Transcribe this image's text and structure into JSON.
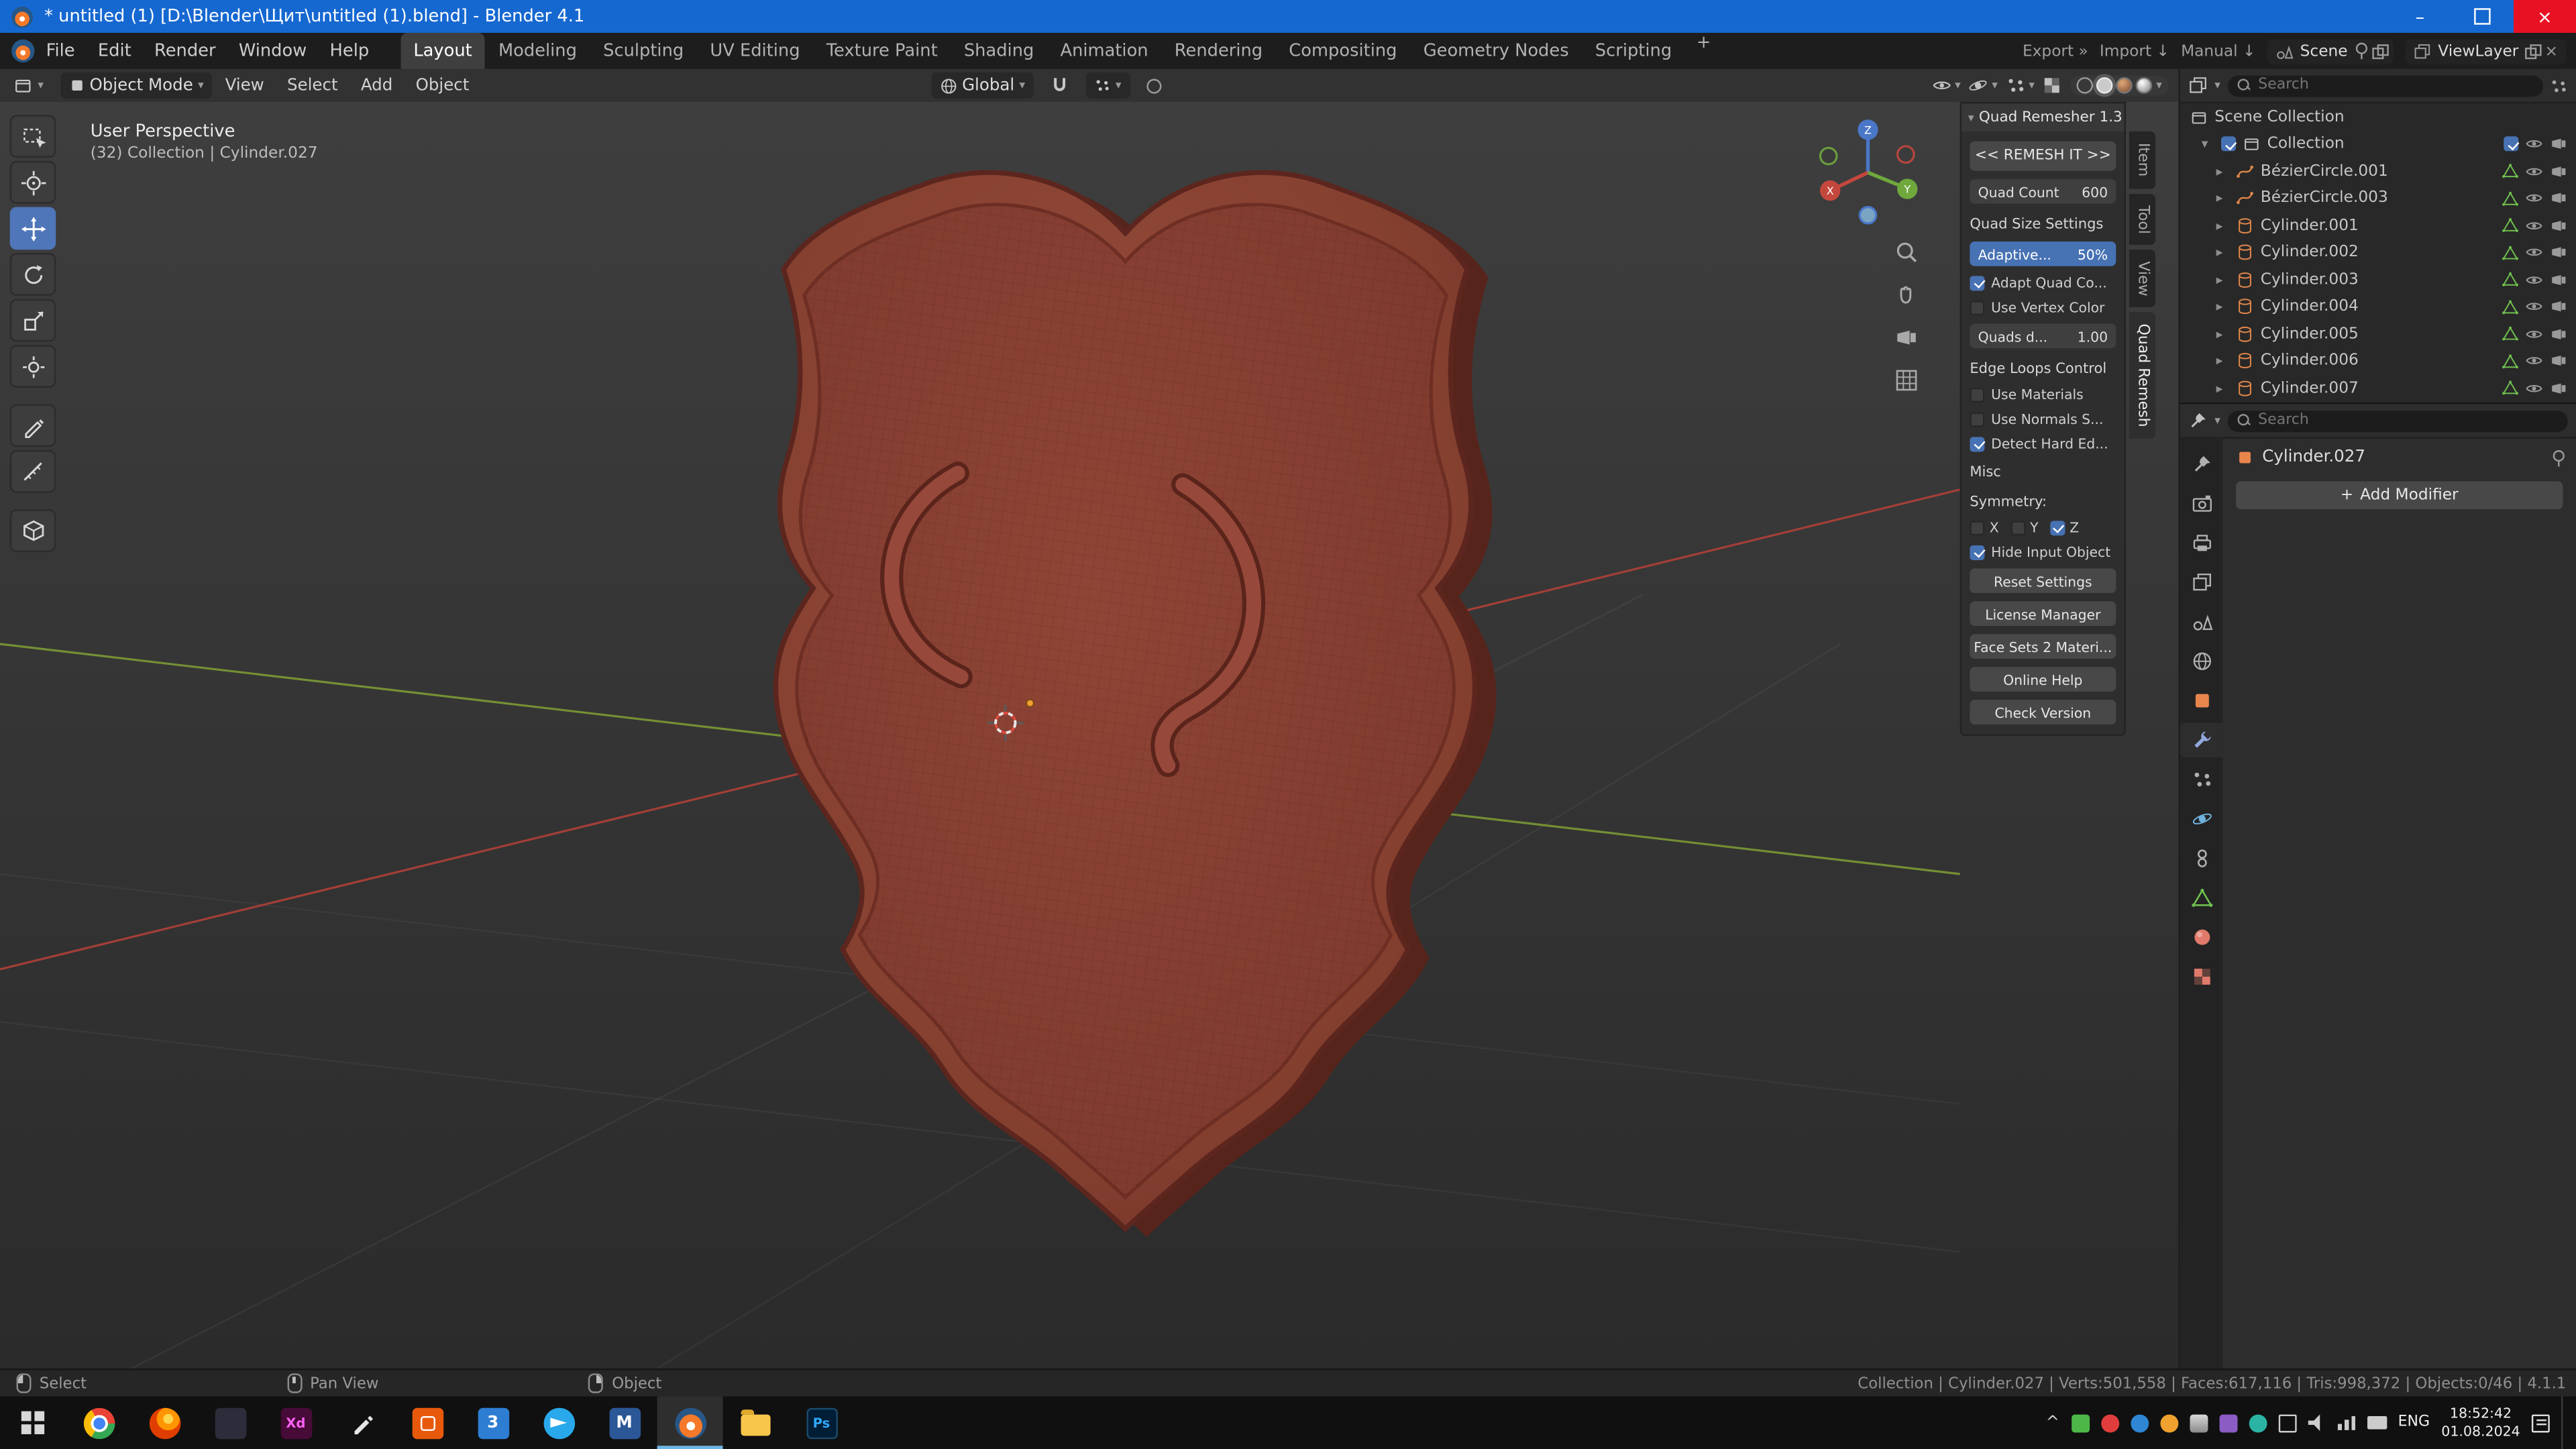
{
  "colors": {
    "titlebar_blue": "#1668d1",
    "accent_blue": "#4772b3",
    "blender_orange": "#f5792a",
    "shield_red": "#8a4136",
    "data_green": "#6fbf4f",
    "object_orange": "#e0864a"
  },
  "icons": {
    "chevron_right": "▸",
    "chevron_down": "▾",
    "triangle_down": "▽",
    "close": "×",
    "plus": "+",
    "minimize": "–",
    "double_arrow": "»",
    "down_arrow": "↓",
    "caret_up": "^"
  },
  "titlebar": {
    "title": "* untitled (1) [D:\\Blender\\Щит\\untitled (1).blend] - Blender 4.1"
  },
  "menubar": {
    "menus": [
      "File",
      "Edit",
      "Render",
      "Window",
      "Help"
    ],
    "workspaces": [
      "Layout",
      "Modeling",
      "Sculpting",
      "UV Editing",
      "Texture Paint",
      "Shading",
      "Animation",
      "Rendering",
      "Compositing",
      "Geometry Nodes",
      "Scripting"
    ],
    "active_workspace": "Layout",
    "export": "Export",
    "import": "Import",
    "manual": "Manual",
    "scene": "Scene",
    "viewlayer": "ViewLayer"
  },
  "viewport": {
    "mode": "Object Mode",
    "menus": [
      "View",
      "Select",
      "Add",
      "Object"
    ],
    "orientation": "Global",
    "overlay_perspective": "User Perspective",
    "overlay_context": "(32) Collection | Cylinder.027",
    "axis_labels": {
      "x": "X",
      "y": "Y",
      "z": "Z"
    }
  },
  "quad_remesher": {
    "title": "Quad Remesher 1.3",
    "remesh_button": "<< REMESH IT >>",
    "quad_count_label": "Quad Count",
    "quad_count_value": "600",
    "quad_size_heading": "Quad Size Settings",
    "adaptive_label": "Adaptive...",
    "adaptive_value": "50%",
    "adapt_quad_label": "Adapt Quad Co...",
    "use_vertex_color_label": "Use Vertex Color",
    "quads_size_label": "Quads d...",
    "quads_size_value": "1.00",
    "edge_loops_heading": "Edge Loops Control",
    "use_materials_label": "Use Materials",
    "use_normals_label": "Use Normals S...",
    "detect_hard_label": "Detect Hard Ed...",
    "misc_heading": "Misc",
    "symmetry_heading": "Symmetry:",
    "sym_x": "X",
    "sym_y": "Y",
    "sym_z": "Z",
    "hide_input_label": "Hide Input Object",
    "btn_reset": "Reset Settings",
    "btn_license": "License Manager",
    "btn_facesets": "Face Sets 2 Materi...",
    "btn_help": "Online Help",
    "btn_version": "Check Version"
  },
  "side_tabs": [
    "Item",
    "Tool",
    "View",
    "Quad Remesh"
  ],
  "outliner": {
    "search_placeholder": "Search",
    "scene_collection": "Scene Collection",
    "collection": "Collection",
    "items": [
      "BézierCircle.001",
      "BézierCircle.003",
      "Cylinder.001",
      "Cylinder.002",
      "Cylinder.003",
      "Cylinder.004",
      "Cylinder.005",
      "Cylinder.006",
      "Cylinder.007"
    ]
  },
  "properties": {
    "search_placeholder": "Search",
    "object_name": "Cylinder.027",
    "add_modifier": "Add Modifier"
  },
  "statusbar": {
    "hint_select": "Select",
    "hint_pan": "Pan View",
    "hint_object": "Object",
    "stats": "Collection | Cylinder.027 | Verts:501,558 | Faces:617,116 | Tris:998,372 | Objects:0/46 | 4.1.1"
  },
  "taskbar": {
    "language": "ENG",
    "time": "18:52:42",
    "date": "01.08.2024",
    "app_3_label": "3",
    "xd_label": "Xd",
    "ps_label": "Ps",
    "mail_label": "M"
  }
}
